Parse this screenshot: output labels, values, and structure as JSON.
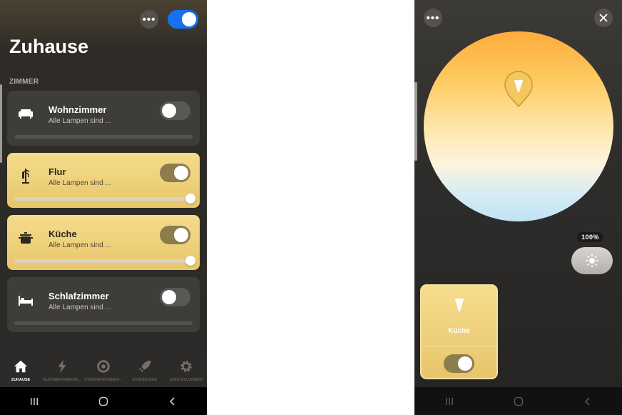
{
  "left": {
    "title": "Zuhause",
    "section_label": "ZIMMER",
    "master_toggle_on": true,
    "rooms": [
      {
        "name": "Wohnzimmer",
        "status": "Alle Lampen sind ...",
        "on": false,
        "icon": "sofa-icon",
        "brightness": 0
      },
      {
        "name": "Flur",
        "status": "Alle Lampen sind ...",
        "on": true,
        "icon": "coat-rack-icon",
        "brightness": 1.0
      },
      {
        "name": "Küche",
        "status": "Alle Lampen sind ...",
        "on": true,
        "icon": "cooking-pot-icon",
        "brightness": 1.0
      },
      {
        "name": "Schlafzimmer",
        "status": "Alle Lampen sind ...",
        "on": false,
        "icon": "bed-icon",
        "brightness": 0
      }
    ],
    "nav": [
      {
        "label": "ZUHAUSE",
        "icon": "home-icon",
        "active": true
      },
      {
        "label": "AUTOMATISIERUN...",
        "icon": "lightning-icon",
        "active": false
      },
      {
        "label": "SYNCHRONISIERU...",
        "icon": "sync-icon",
        "active": false
      },
      {
        "label": "ENTDECKEN",
        "icon": "rocket-icon",
        "active": false
      },
      {
        "label": "EINSTELLUNGEN",
        "icon": "gear-icon",
        "active": false
      }
    ]
  },
  "right": {
    "brightness_label": "100%",
    "light_name": "Küche",
    "light_on": true
  },
  "colors": {
    "accent_blue": "#1670f0",
    "card_on": "#f0d57e",
    "card_off": "#3f3d3a"
  }
}
